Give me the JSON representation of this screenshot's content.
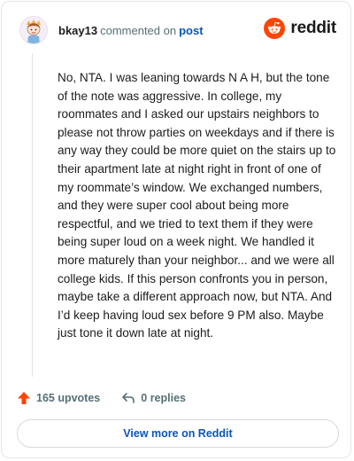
{
  "header": {
    "username": "bkay13",
    "verb": "commented on",
    "post_link": "post",
    "logo_text": "reddit",
    "brand_color": "#ff4500",
    "avatar_icon": "cartoon-avatar-icon"
  },
  "comment": {
    "body": "No, NTA. I was leaning towards N A H, but the tone of the note was aggressive. In college, my roommates and I asked our upstairs neighbors to please not throw parties on weekdays and if there is any way they could be more quiet on the stairs up to their apartment late at night right in front of one of my roommate’s window. We exchanged numbers, and they were super cool about being more respectful, and we tried to text them if they were being super loud on a week night. We handled it more maturely than your neighbor... and we were all college kids. If this person confronts you in person, maybe take a different approach now, but NTA. And I’d keep having loud sex before 9 PM also. Maybe just tone it down late at night."
  },
  "actions": {
    "upvotes_label": "165 upvotes",
    "replies_label": "0 replies",
    "upvote_color": "#ff4500"
  },
  "footer": {
    "view_more_label": "View more on Reddit"
  }
}
